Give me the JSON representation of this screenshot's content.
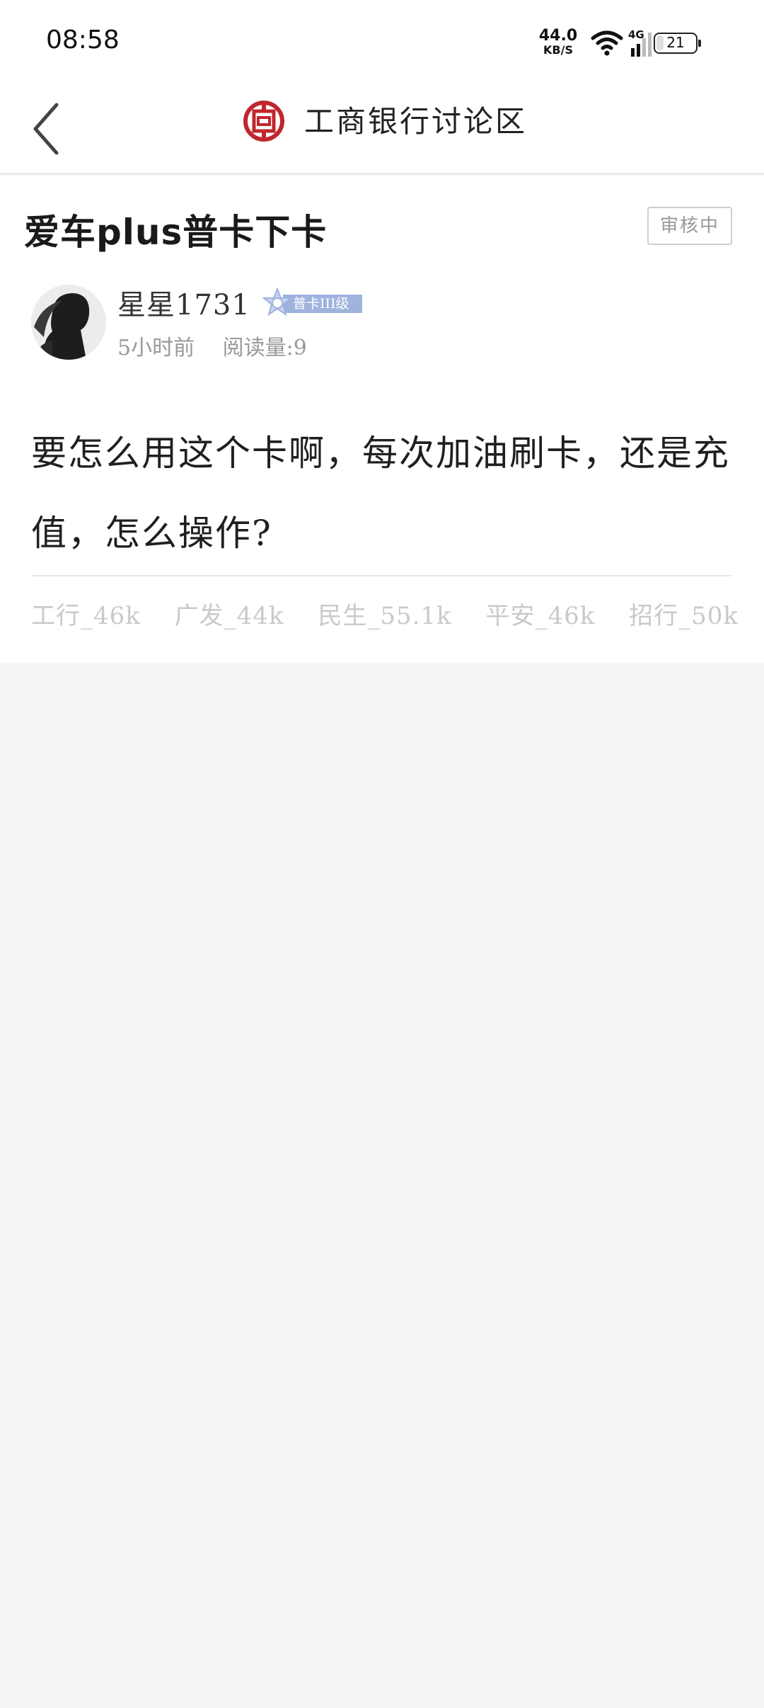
{
  "status_bar": {
    "time": "08:58",
    "net_speed_value": "44.0",
    "net_speed_unit": "KB/S",
    "network_type": "4G",
    "battery": "21"
  },
  "header": {
    "title": "工商银行讨论区",
    "logo": "icbc-logo-icon",
    "brand_color": "#c0272d"
  },
  "post": {
    "title": "爱车plus普卡下卡",
    "review_status": "审核中",
    "author": {
      "name": "星星1731",
      "level_badge": "普卡III级"
    },
    "time_ago": "5小时前",
    "read_count": "阅读量:9",
    "body": "要怎么用这个卡啊，每次加油刷卡，还是充值，怎么操作?",
    "tags": [
      "工行_46k",
      "广发_44k",
      "民生_55.1k",
      "平安_46k",
      "招行_50k"
    ]
  }
}
